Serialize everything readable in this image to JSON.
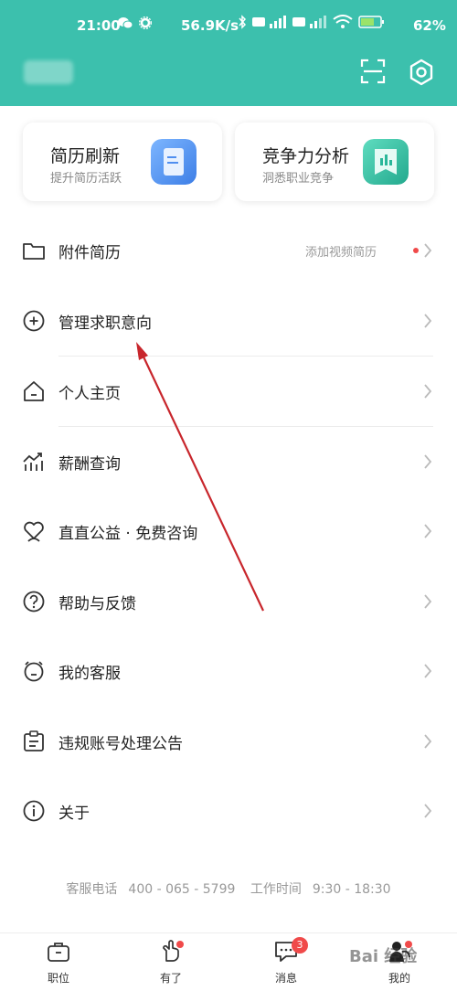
{
  "status": {
    "time": "21:00",
    "network_speed": "56.9K/s",
    "battery": "62%"
  },
  "cards": [
    {
      "title": "简历刷新",
      "subtitle": "提升简历活跃",
      "icon": "resume-doc-icon",
      "color": "#4f8ef0"
    },
    {
      "title": "竞争力分析",
      "subtitle": "洞悉职业竞争",
      "icon": "chart-flag-icon",
      "color": "#3cc0ad"
    }
  ],
  "menu": [
    {
      "label": "附件简历",
      "extra": "添加视频简历",
      "icon": "folder-icon"
    },
    {
      "label": "管理求职意向",
      "icon": "plus-circle-icon"
    },
    {
      "label": "个人主页",
      "icon": "home-icon"
    },
    {
      "label": "薪酬查询",
      "icon": "salary-chart-icon"
    },
    {
      "label": "直直公益 · 免费咨询",
      "icon": "heart-hands-icon"
    },
    {
      "label": "帮助与反馈",
      "icon": "help-icon"
    },
    {
      "label": "我的客服",
      "icon": "customer-service-icon"
    },
    {
      "label": "违规账号处理公告",
      "icon": "notice-clipboard-icon"
    },
    {
      "label": "关于",
      "icon": "info-icon"
    }
  ],
  "contact": {
    "phone_label": "客服电话",
    "phone": "400 - 065 - 5799",
    "hours_label": "工作时间",
    "hours": "9:30 - 18:30"
  },
  "tabs": [
    {
      "label": "职位",
      "icon": "briefcase-icon"
    },
    {
      "label": "有了",
      "icon": "hand-icon",
      "dot": true
    },
    {
      "label": "消息",
      "icon": "message-icon",
      "badge": "3"
    },
    {
      "label": "我的",
      "icon": "profile-icon",
      "dot": true,
      "active": true
    }
  ],
  "watermark": "Bai 经验",
  "colors": {
    "brand": "#3cc0ad",
    "badge": "#f04a4a",
    "arrow": "#c8262c"
  }
}
